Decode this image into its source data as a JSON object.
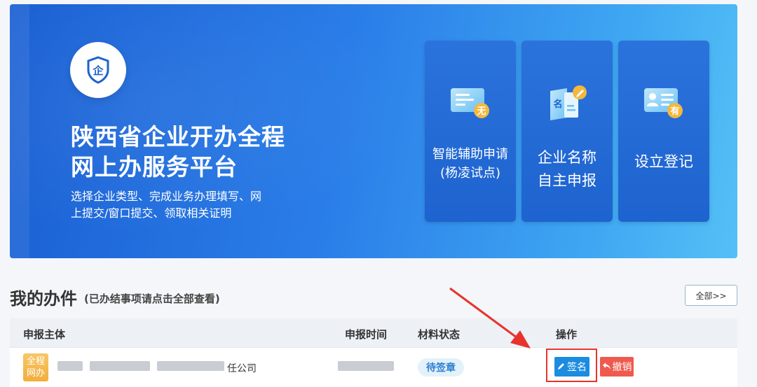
{
  "hero": {
    "title_line1": "陕西省企业开办全程",
    "title_line2": "网上办服务平台",
    "subtitle_line1": "选择企业类型、完成业务办理填写、网",
    "subtitle_line2": "上提交/窗口提交、领取相关证明",
    "emblem_text": "企",
    "cards": [
      {
        "line1": "智能辅助申请",
        "line2": "(杨凌试点)",
        "icon": "id-card-no-icon",
        "icon_badge": "无"
      },
      {
        "line1": "企业名称",
        "line2": "自主申报",
        "icon": "name-card-edit-icon",
        "icon_badge": "名"
      },
      {
        "line1": "设立登记",
        "icon": "registration-card-icon",
        "icon_badge": "有"
      }
    ]
  },
  "section": {
    "title": "我的办件",
    "hint": "(已办结事项请点击全部查看)",
    "all_button": "全部>>"
  },
  "table": {
    "headers": [
      "申报主体",
      "申报时间",
      "材料状态",
      "操作"
    ],
    "rows": [
      {
        "badge_line1": "全程",
        "badge_line2": "网办",
        "company_suffix": "任公司",
        "status": "待签章",
        "sign_label": "签名",
        "revoke_label": "撤销"
      }
    ]
  },
  "colors": {
    "hero_start": "#1a5fd3",
    "hero_end": "#54c0f6",
    "card_bg": "#2169d5",
    "sign_button": "#1b8ce0",
    "revoke_button": "#ef5a4e",
    "highlight": "#e8332d",
    "status_text": "#2b7fd0"
  }
}
